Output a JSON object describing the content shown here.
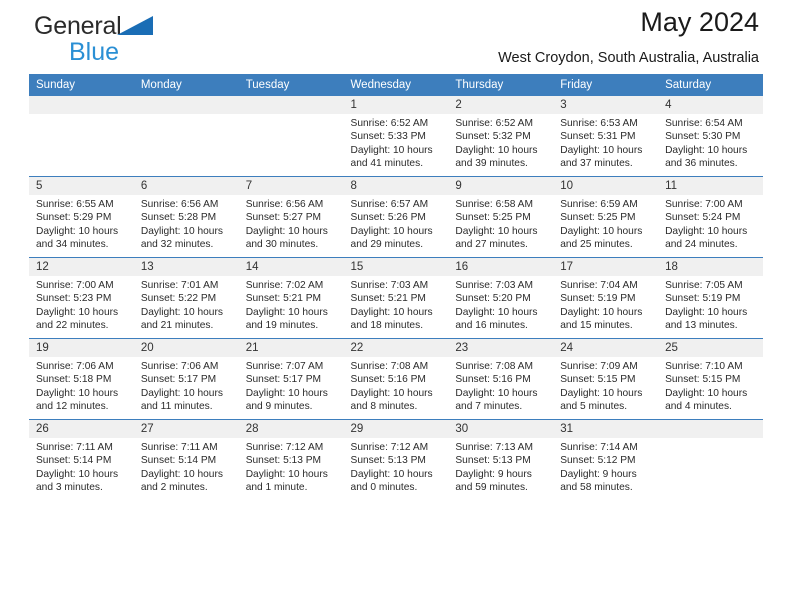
{
  "brand": {
    "line1": "General",
    "line2": "Blue",
    "triangle_color": "#1a6db5",
    "text_color": "#2b2b2b",
    "accent_color": "#2a8fd4"
  },
  "header": {
    "title": "May 2024",
    "subtitle": "West Croydon, South Australia, Australia"
  },
  "theme": {
    "header_row_bg": "#3d7ebd",
    "header_row_text": "#ffffff",
    "daynum_bg": "#f0f0f0",
    "row_divider": "#3d7ebd"
  },
  "weekday_headers": [
    "Sunday",
    "Monday",
    "Tuesday",
    "Wednesday",
    "Thursday",
    "Friday",
    "Saturday"
  ],
  "labels": {
    "sunrise_prefix": "Sunrise:",
    "sunset_prefix": "Sunset:",
    "daylight_prefix": "Daylight:"
  },
  "weeks": [
    [
      {
        "day": "",
        "empty": true
      },
      {
        "day": "",
        "empty": true
      },
      {
        "day": "",
        "empty": true
      },
      {
        "day": "1",
        "sunrise": "Sunrise: 6:52 AM",
        "sunset": "Sunset: 5:33 PM",
        "daylight_1": "Daylight: 10 hours",
        "daylight_2": "and 41 minutes."
      },
      {
        "day": "2",
        "sunrise": "Sunrise: 6:52 AM",
        "sunset": "Sunset: 5:32 PM",
        "daylight_1": "Daylight: 10 hours",
        "daylight_2": "and 39 minutes."
      },
      {
        "day": "3",
        "sunrise": "Sunrise: 6:53 AM",
        "sunset": "Sunset: 5:31 PM",
        "daylight_1": "Daylight: 10 hours",
        "daylight_2": "and 37 minutes."
      },
      {
        "day": "4",
        "sunrise": "Sunrise: 6:54 AM",
        "sunset": "Sunset: 5:30 PM",
        "daylight_1": "Daylight: 10 hours",
        "daylight_2": "and 36 minutes."
      }
    ],
    [
      {
        "day": "5",
        "sunrise": "Sunrise: 6:55 AM",
        "sunset": "Sunset: 5:29 PM",
        "daylight_1": "Daylight: 10 hours",
        "daylight_2": "and 34 minutes."
      },
      {
        "day": "6",
        "sunrise": "Sunrise: 6:56 AM",
        "sunset": "Sunset: 5:28 PM",
        "daylight_1": "Daylight: 10 hours",
        "daylight_2": "and 32 minutes."
      },
      {
        "day": "7",
        "sunrise": "Sunrise: 6:56 AM",
        "sunset": "Sunset: 5:27 PM",
        "daylight_1": "Daylight: 10 hours",
        "daylight_2": "and 30 minutes."
      },
      {
        "day": "8",
        "sunrise": "Sunrise: 6:57 AM",
        "sunset": "Sunset: 5:26 PM",
        "daylight_1": "Daylight: 10 hours",
        "daylight_2": "and 29 minutes."
      },
      {
        "day": "9",
        "sunrise": "Sunrise: 6:58 AM",
        "sunset": "Sunset: 5:25 PM",
        "daylight_1": "Daylight: 10 hours",
        "daylight_2": "and 27 minutes."
      },
      {
        "day": "10",
        "sunrise": "Sunrise: 6:59 AM",
        "sunset": "Sunset: 5:25 PM",
        "daylight_1": "Daylight: 10 hours",
        "daylight_2": "and 25 minutes."
      },
      {
        "day": "11",
        "sunrise": "Sunrise: 7:00 AM",
        "sunset": "Sunset: 5:24 PM",
        "daylight_1": "Daylight: 10 hours",
        "daylight_2": "and 24 minutes."
      }
    ],
    [
      {
        "day": "12",
        "sunrise": "Sunrise: 7:00 AM",
        "sunset": "Sunset: 5:23 PM",
        "daylight_1": "Daylight: 10 hours",
        "daylight_2": "and 22 minutes."
      },
      {
        "day": "13",
        "sunrise": "Sunrise: 7:01 AM",
        "sunset": "Sunset: 5:22 PM",
        "daylight_1": "Daylight: 10 hours",
        "daylight_2": "and 21 minutes."
      },
      {
        "day": "14",
        "sunrise": "Sunrise: 7:02 AM",
        "sunset": "Sunset: 5:21 PM",
        "daylight_1": "Daylight: 10 hours",
        "daylight_2": "and 19 minutes."
      },
      {
        "day": "15",
        "sunrise": "Sunrise: 7:03 AM",
        "sunset": "Sunset: 5:21 PM",
        "daylight_1": "Daylight: 10 hours",
        "daylight_2": "and 18 minutes."
      },
      {
        "day": "16",
        "sunrise": "Sunrise: 7:03 AM",
        "sunset": "Sunset: 5:20 PM",
        "daylight_1": "Daylight: 10 hours",
        "daylight_2": "and 16 minutes."
      },
      {
        "day": "17",
        "sunrise": "Sunrise: 7:04 AM",
        "sunset": "Sunset: 5:19 PM",
        "daylight_1": "Daylight: 10 hours",
        "daylight_2": "and 15 minutes."
      },
      {
        "day": "18",
        "sunrise": "Sunrise: 7:05 AM",
        "sunset": "Sunset: 5:19 PM",
        "daylight_1": "Daylight: 10 hours",
        "daylight_2": "and 13 minutes."
      }
    ],
    [
      {
        "day": "19",
        "sunrise": "Sunrise: 7:06 AM",
        "sunset": "Sunset: 5:18 PM",
        "daylight_1": "Daylight: 10 hours",
        "daylight_2": "and 12 minutes."
      },
      {
        "day": "20",
        "sunrise": "Sunrise: 7:06 AM",
        "sunset": "Sunset: 5:17 PM",
        "daylight_1": "Daylight: 10 hours",
        "daylight_2": "and 11 minutes."
      },
      {
        "day": "21",
        "sunrise": "Sunrise: 7:07 AM",
        "sunset": "Sunset: 5:17 PM",
        "daylight_1": "Daylight: 10 hours",
        "daylight_2": "and 9 minutes."
      },
      {
        "day": "22",
        "sunrise": "Sunrise: 7:08 AM",
        "sunset": "Sunset: 5:16 PM",
        "daylight_1": "Daylight: 10 hours",
        "daylight_2": "and 8 minutes."
      },
      {
        "day": "23",
        "sunrise": "Sunrise: 7:08 AM",
        "sunset": "Sunset: 5:16 PM",
        "daylight_1": "Daylight: 10 hours",
        "daylight_2": "and 7 minutes."
      },
      {
        "day": "24",
        "sunrise": "Sunrise: 7:09 AM",
        "sunset": "Sunset: 5:15 PM",
        "daylight_1": "Daylight: 10 hours",
        "daylight_2": "and 5 minutes."
      },
      {
        "day": "25",
        "sunrise": "Sunrise: 7:10 AM",
        "sunset": "Sunset: 5:15 PM",
        "daylight_1": "Daylight: 10 hours",
        "daylight_2": "and 4 minutes."
      }
    ],
    [
      {
        "day": "26",
        "sunrise": "Sunrise: 7:11 AM",
        "sunset": "Sunset: 5:14 PM",
        "daylight_1": "Daylight: 10 hours",
        "daylight_2": "and 3 minutes."
      },
      {
        "day": "27",
        "sunrise": "Sunrise: 7:11 AM",
        "sunset": "Sunset: 5:14 PM",
        "daylight_1": "Daylight: 10 hours",
        "daylight_2": "and 2 minutes."
      },
      {
        "day": "28",
        "sunrise": "Sunrise: 7:12 AM",
        "sunset": "Sunset: 5:13 PM",
        "daylight_1": "Daylight: 10 hours",
        "daylight_2": "and 1 minute."
      },
      {
        "day": "29",
        "sunrise": "Sunrise: 7:12 AM",
        "sunset": "Sunset: 5:13 PM",
        "daylight_1": "Daylight: 10 hours",
        "daylight_2": "and 0 minutes."
      },
      {
        "day": "30",
        "sunrise": "Sunrise: 7:13 AM",
        "sunset": "Sunset: 5:13 PM",
        "daylight_1": "Daylight: 9 hours",
        "daylight_2": "and 59 minutes."
      },
      {
        "day": "31",
        "sunrise": "Sunrise: 7:14 AM",
        "sunset": "Sunset: 5:12 PM",
        "daylight_1": "Daylight: 9 hours",
        "daylight_2": "and 58 minutes."
      },
      {
        "day": "",
        "empty": true
      }
    ]
  ]
}
